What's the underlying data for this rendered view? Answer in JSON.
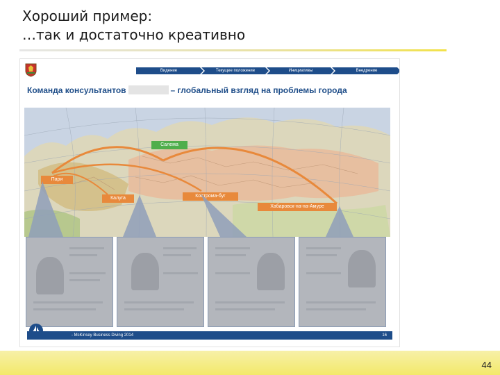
{
  "slide": {
    "title_line1": "Хороший пример:",
    "title_line2": "…так и достаточно креативно",
    "page_number": "44"
  },
  "inner_slide": {
    "nav": [
      "Видение",
      "Текущее положение",
      "Инициативы",
      "Внедрение"
    ],
    "heading_left": "Команда консультантов",
    "heading_right": "– глобальный взгляд на проблемы города",
    "cities": {
      "green": "Салема",
      "orange_1": "Пари",
      "orange_2": "Калуга",
      "orange_3": "Кострома-буг",
      "orange_4": "Хабаровск-на-на-Амуре"
    },
    "footer_text": "- McKinsey Business Diving 2014",
    "footer_page": "16"
  },
  "colors": {
    "nav_blue": "#1e4d8a",
    "heading_blue": "#1f4e89",
    "city_green": "#4fae4c",
    "city_orange": "#e8893b",
    "accent_yellow": "#f3e96a"
  }
}
